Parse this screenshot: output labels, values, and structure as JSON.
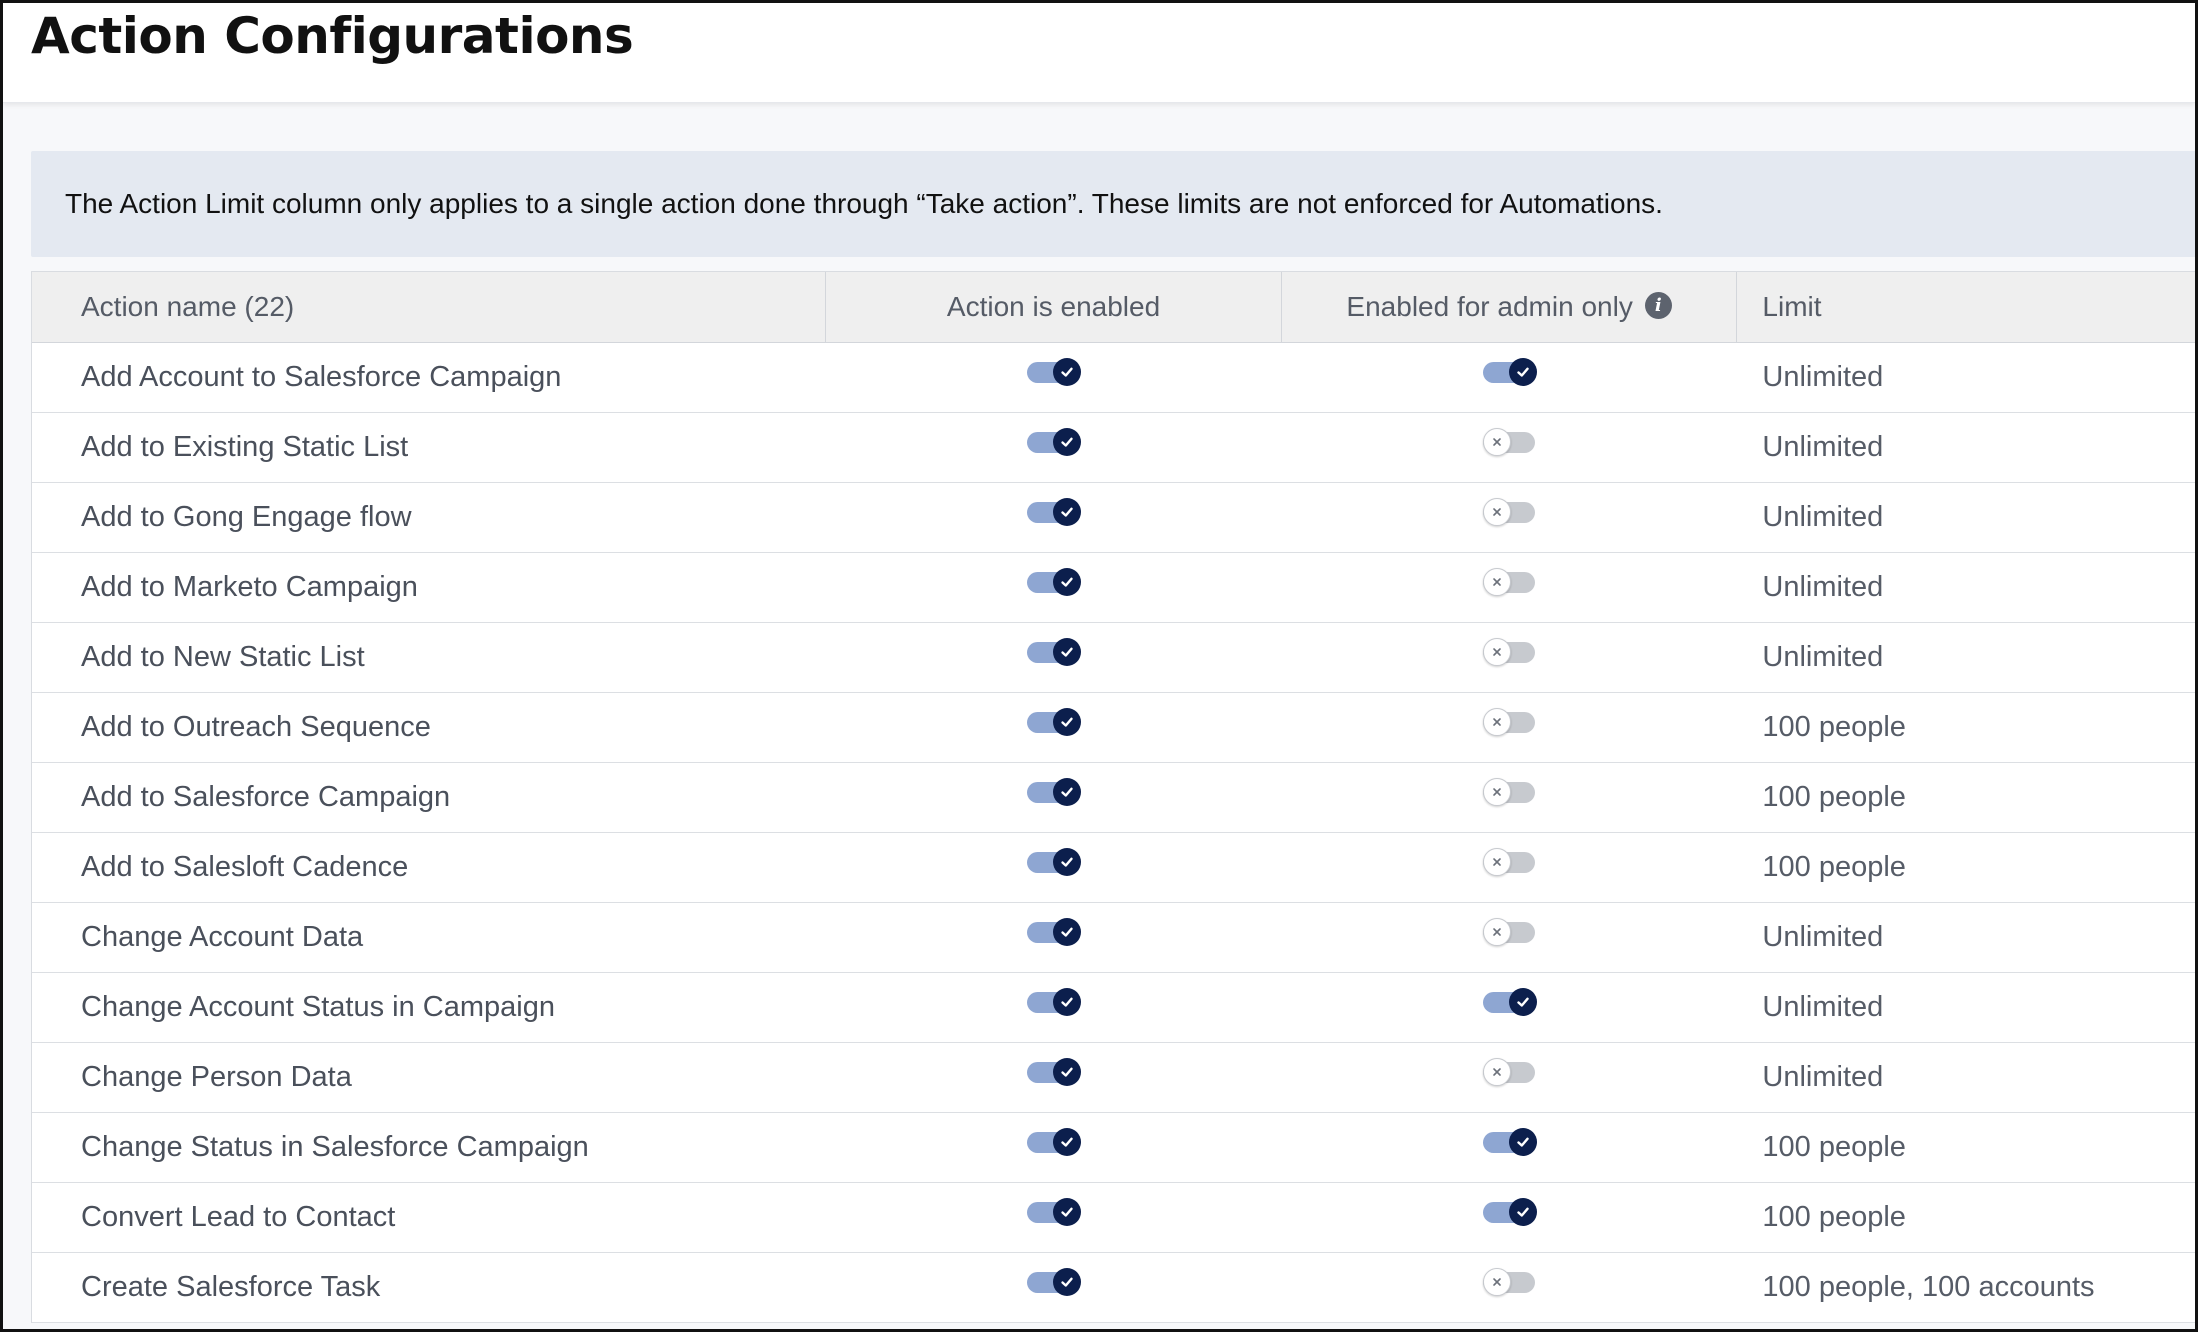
{
  "page": {
    "title": "Action Configurations"
  },
  "banner": {
    "text": "The Action Limit column only applies to a single action done through “Take action”. These limits are not enforced for Automations."
  },
  "table": {
    "columns": {
      "name": "Action name (22)",
      "enabled": "Action is enabled",
      "admin_only": "Enabled for admin only",
      "limit": "Limit"
    },
    "rows": [
      {
        "name": "Add Account to Salesforce Campaign",
        "enabled": true,
        "admin_only": true,
        "limit": "Unlimited"
      },
      {
        "name": "Add to Existing Static List",
        "enabled": true,
        "admin_only": false,
        "limit": "Unlimited"
      },
      {
        "name": "Add to Gong Engage flow",
        "enabled": true,
        "admin_only": false,
        "limit": "Unlimited"
      },
      {
        "name": "Add to Marketo Campaign",
        "enabled": true,
        "admin_only": false,
        "limit": "Unlimited"
      },
      {
        "name": "Add to New Static List",
        "enabled": true,
        "admin_only": false,
        "limit": "Unlimited"
      },
      {
        "name": "Add to Outreach Sequence",
        "enabled": true,
        "admin_only": false,
        "limit": "100 people"
      },
      {
        "name": "Add to Salesforce Campaign",
        "enabled": true,
        "admin_only": false,
        "limit": "100 people"
      },
      {
        "name": "Add to Salesloft Cadence",
        "enabled": true,
        "admin_only": false,
        "limit": "100 people"
      },
      {
        "name": "Change Account Data",
        "enabled": true,
        "admin_only": false,
        "limit": "Unlimited"
      },
      {
        "name": "Change Account Status in Campaign",
        "enabled": true,
        "admin_only": true,
        "limit": "Unlimited"
      },
      {
        "name": "Change Person Data",
        "enabled": true,
        "admin_only": false,
        "limit": "Unlimited"
      },
      {
        "name": "Change Status in Salesforce Campaign",
        "enabled": true,
        "admin_only": true,
        "limit": "100 people"
      },
      {
        "name": "Convert Lead to Contact",
        "enabled": true,
        "admin_only": true,
        "limit": "100 people"
      },
      {
        "name": "Create Salesforce Task",
        "enabled": true,
        "admin_only": false,
        "limit": "100 people, 100 accounts"
      }
    ]
  },
  "icons": {
    "info": "info-icon",
    "toggle_on": "check-icon",
    "toggle_off": "x-icon"
  },
  "colors": {
    "toggle_on_track": "#8ea6d2",
    "toggle_on_knob": "#0c1f4d",
    "toggle_off_track": "#c7cacf",
    "banner_bg": "#e4e9f1",
    "header_row_bg": "#efefef"
  }
}
